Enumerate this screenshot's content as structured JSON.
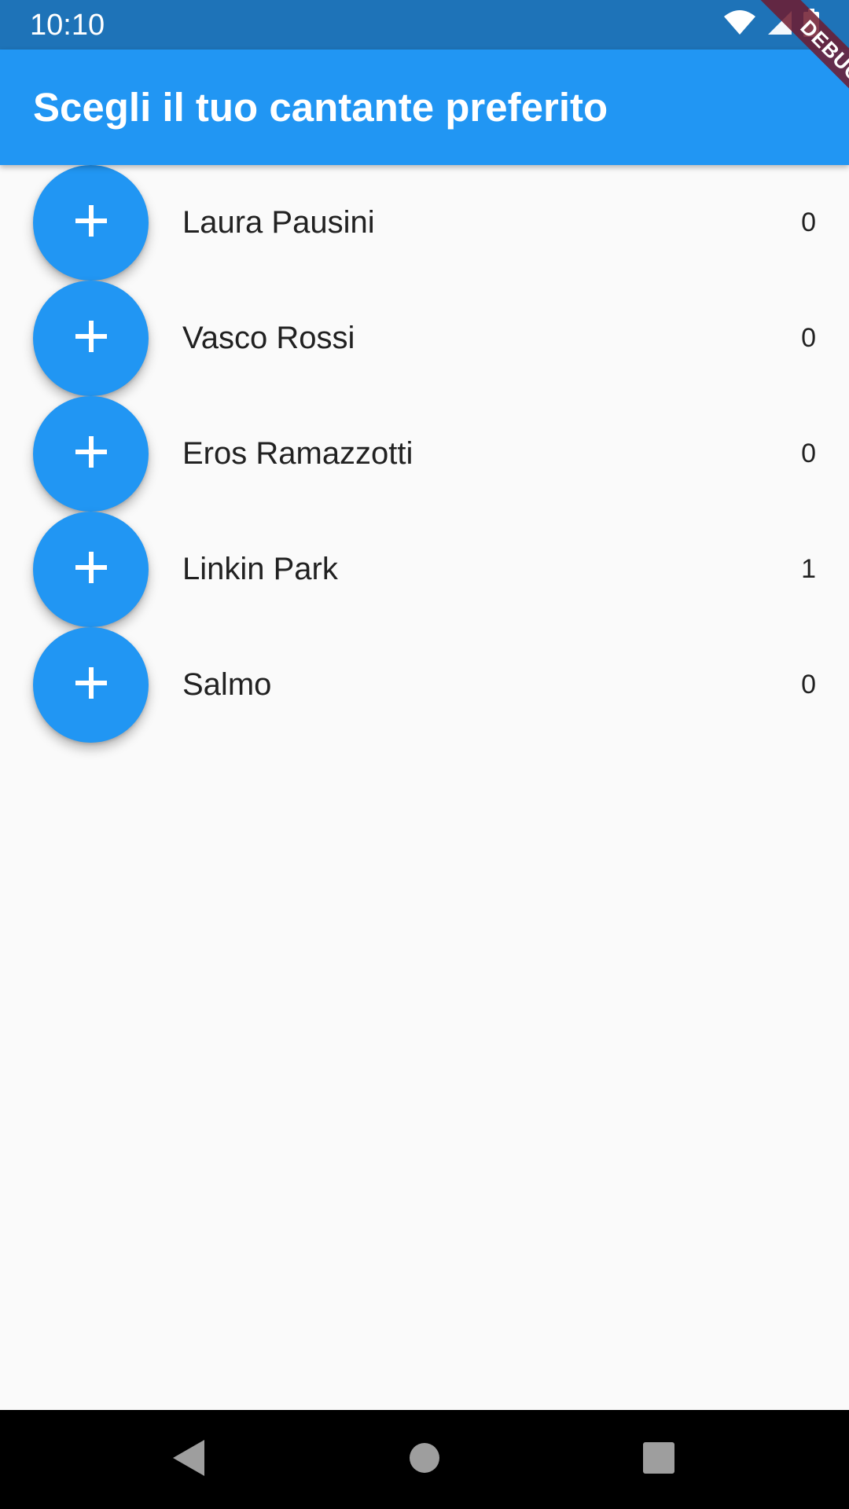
{
  "status_bar": {
    "time": "10:10",
    "icons": [
      "wifi-icon",
      "signal-icon",
      "battery-icon"
    ]
  },
  "app_bar": {
    "title": "Scegli il tuo cantante preferito"
  },
  "debug_banner": {
    "label": "DEBUG"
  },
  "singers": [
    {
      "name": "Laura Pausini",
      "votes": "0",
      "button_icon": "add-icon"
    },
    {
      "name": "Vasco Rossi",
      "votes": "0",
      "button_icon": "add-icon"
    },
    {
      "name": "Eros Ramazzotti",
      "votes": "0",
      "button_icon": "add-icon"
    },
    {
      "name": "Linkin Park",
      "votes": "1",
      "button_icon": "add-icon"
    },
    {
      "name": "Salmo",
      "votes": "0",
      "button_icon": "add-icon"
    }
  ],
  "nav_bar": {
    "buttons": [
      "back-icon",
      "home-icon",
      "recents-icon"
    ]
  },
  "colors": {
    "primary": "#2196f3",
    "status_bar": "#1e73b8",
    "background": "#fafafa",
    "debug_banner": "#6e1a2e"
  }
}
